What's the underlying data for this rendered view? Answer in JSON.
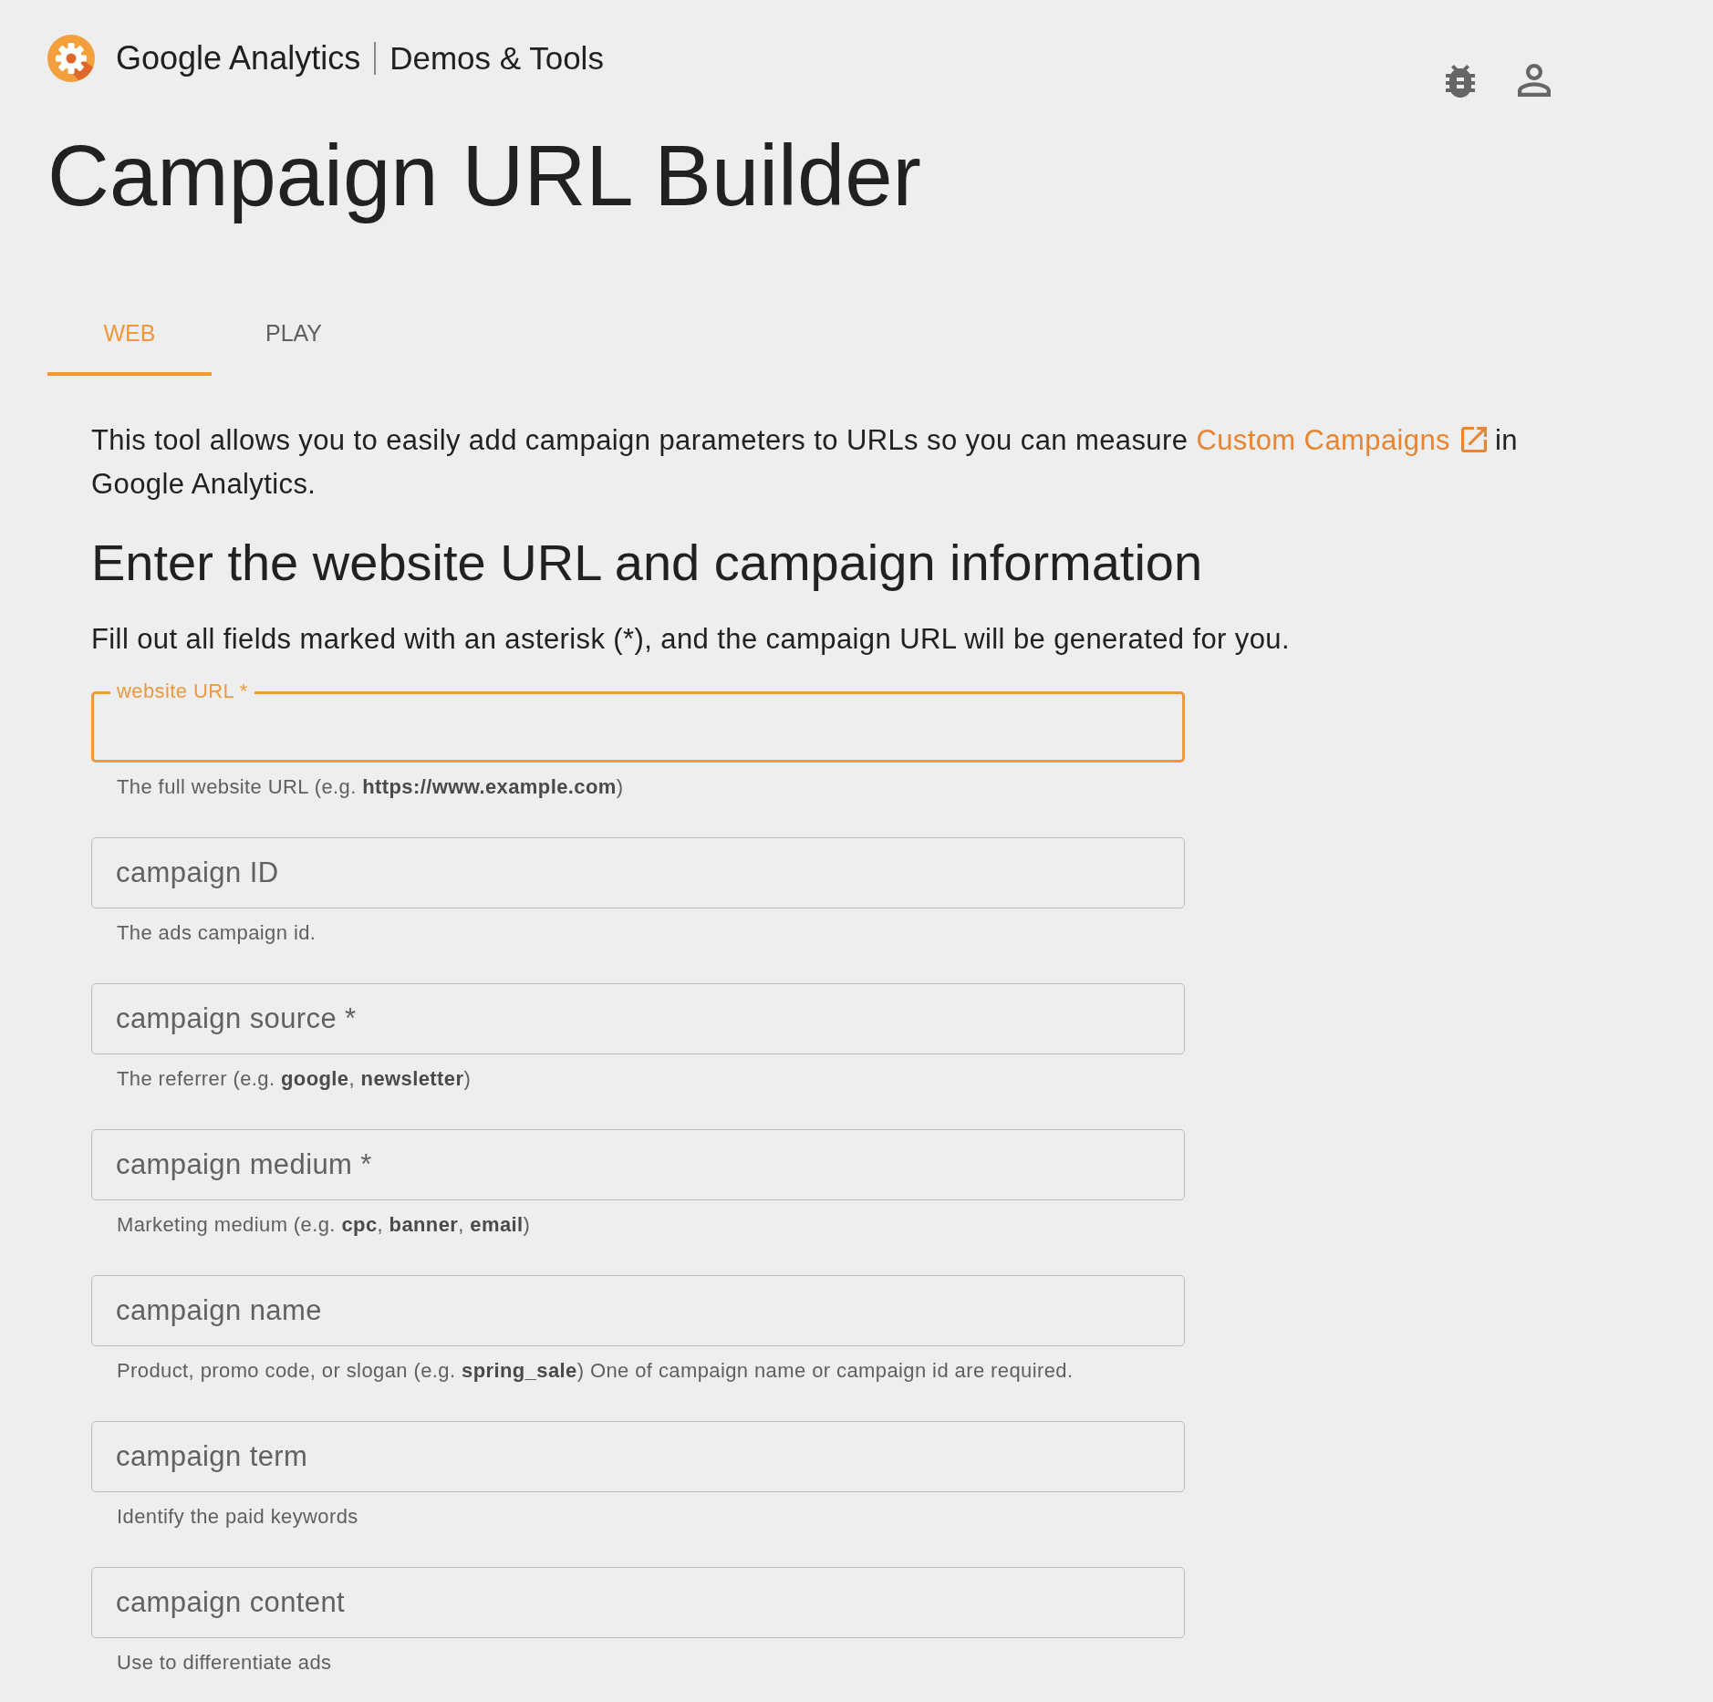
{
  "header": {
    "brand": "Google Analytics",
    "product": "Demos & Tools"
  },
  "page_title": "Campaign URL Builder",
  "tabs": [
    {
      "label": "WEB",
      "selected": true
    },
    {
      "label": "PLAY",
      "selected": false
    }
  ],
  "intro": {
    "text_before": "This tool allows you to easily add campaign parameters to URLs so you can measure",
    "link": "Custom Campaigns",
    "text_after": "in Google Analytics."
  },
  "section_heading": "Enter the website URL and campaign information",
  "instructions": "Fill out all fields marked with an asterisk (*), and the campaign URL will be generated for you.",
  "fields": [
    {
      "label": "website URL *",
      "focused": true,
      "helper": "The full website URL (e.g. **https://www.example.com**)"
    },
    {
      "label": "campaign ID",
      "focused": false,
      "helper": "The ads campaign id."
    },
    {
      "label": "campaign source *",
      "focused": false,
      "helper": "The referrer (e.g. **google**, **newsletter**)"
    },
    {
      "label": "campaign medium *",
      "focused": false,
      "helper": "Marketing medium (e.g. **cpc**, **banner**, **email**)"
    },
    {
      "label": "campaign name",
      "focused": false,
      "helper": "Product, promo code, or slogan (e.g. **spring_sale**) One of campaign name or campaign id are required."
    },
    {
      "label": "campaign term",
      "focused": false,
      "helper": "Identify the paid keywords"
    },
    {
      "label": "campaign content",
      "focused": false,
      "helper": "Use to differentiate ads"
    }
  ]
}
